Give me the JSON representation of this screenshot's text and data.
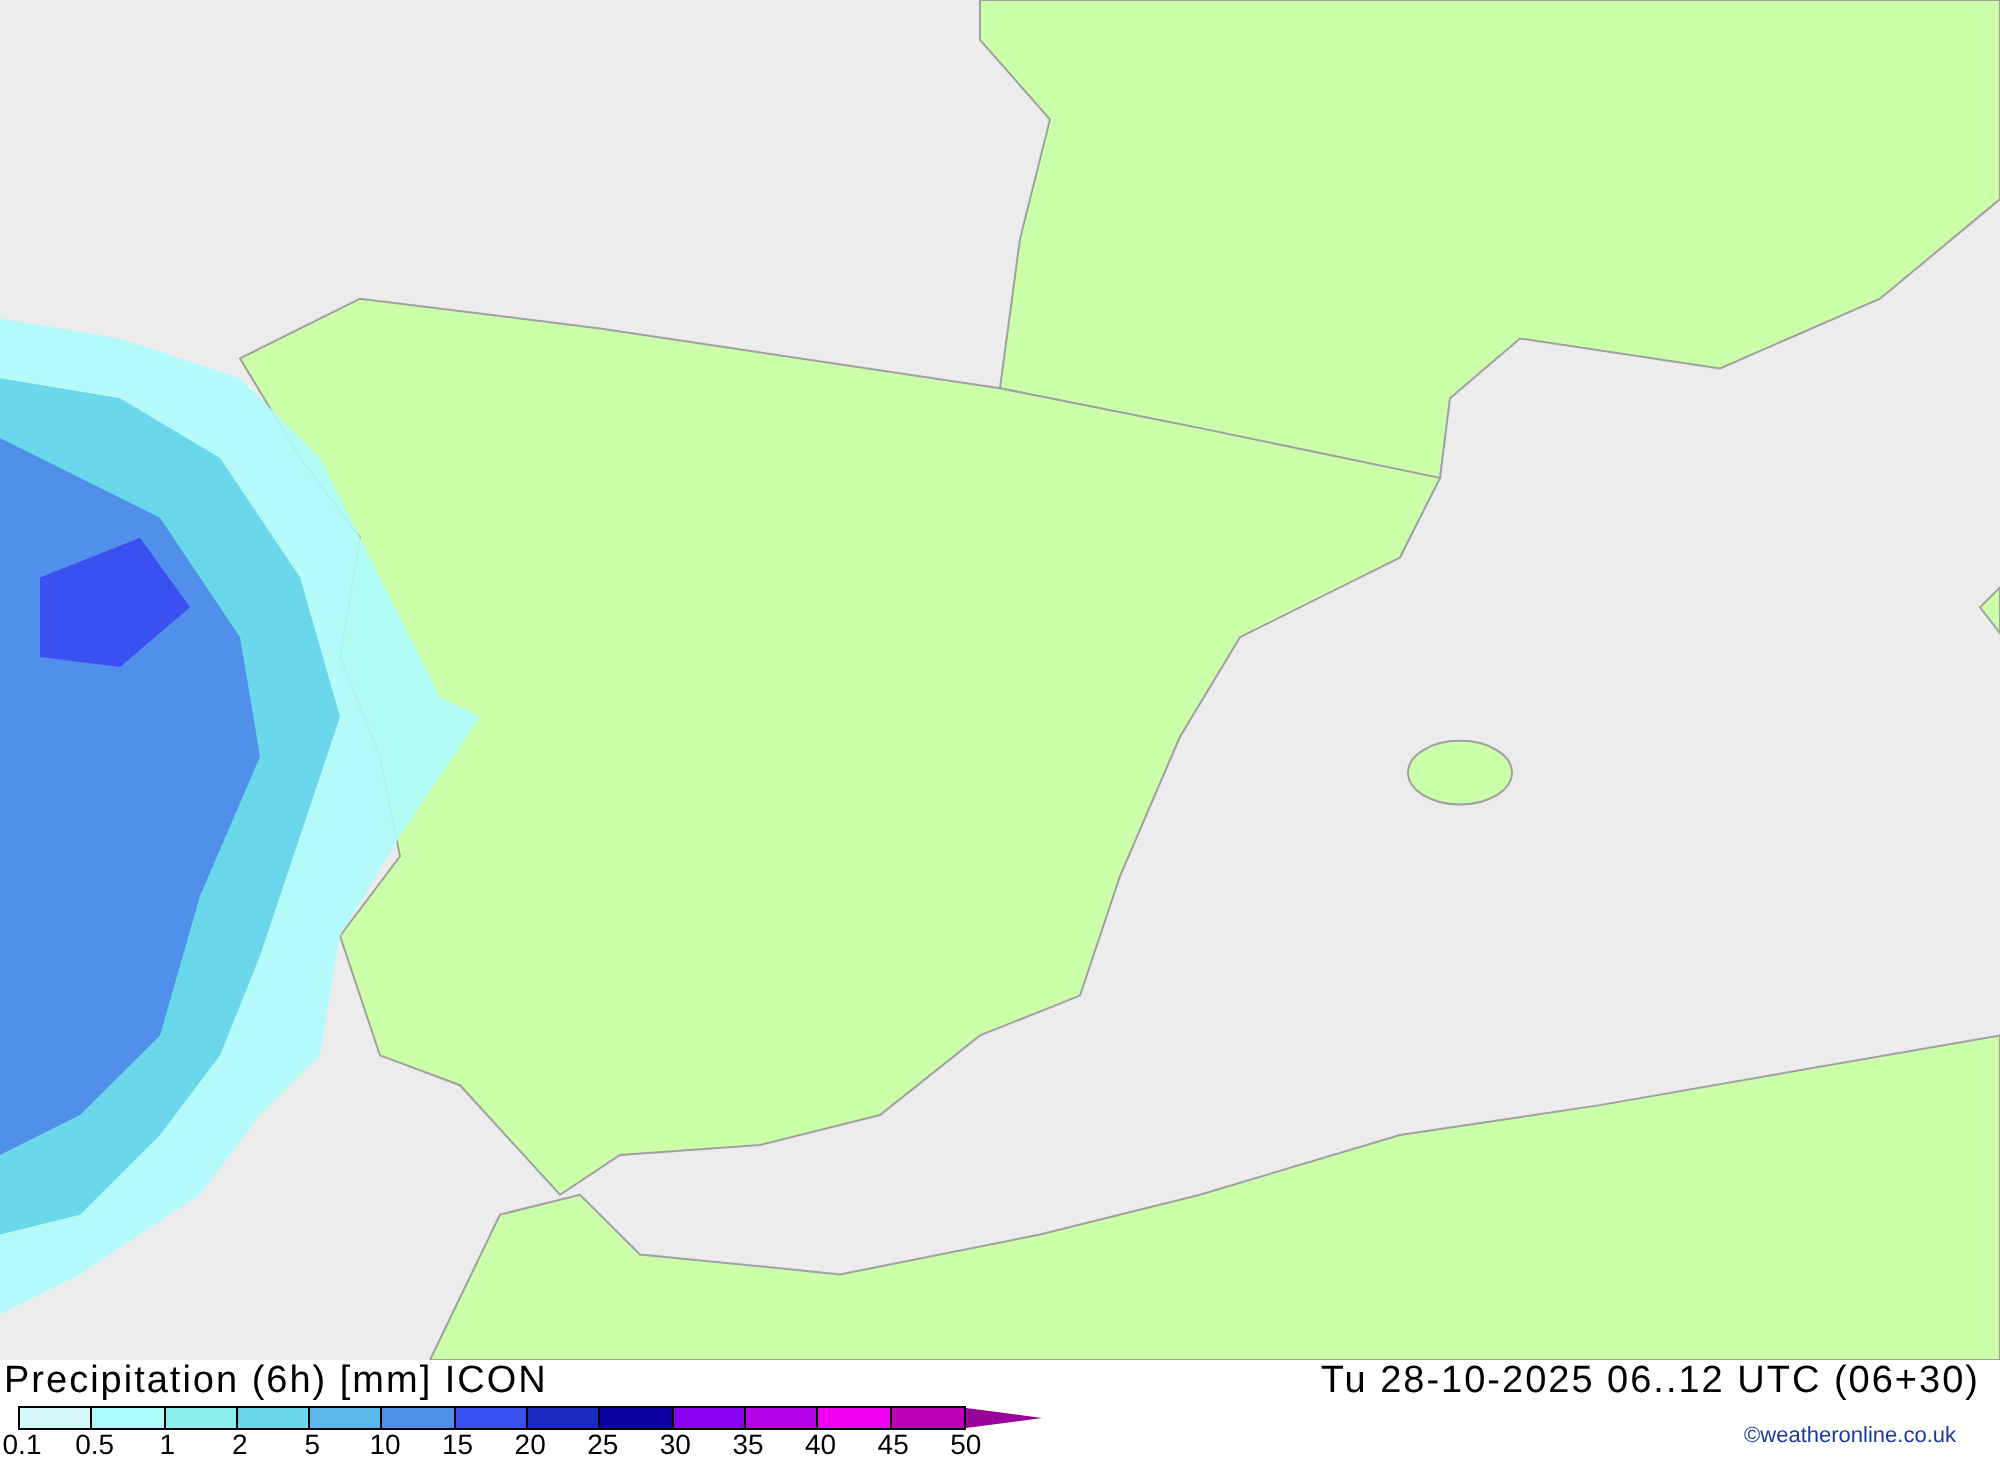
{
  "legend": {
    "title": "Precipitation (6h) [mm] ICON",
    "valid_time": "Tu 28-10-2025 06..12 UTC (06+30)",
    "segments": [
      {
        "color": "#d4f8f8"
      },
      {
        "color": "#aefcfc"
      },
      {
        "color": "#8ceeea"
      },
      {
        "color": "#6ad8ea"
      },
      {
        "color": "#5ab8ea"
      },
      {
        "color": "#5090ea"
      },
      {
        "color": "#3a50f0"
      },
      {
        "color": "#1a2ac0"
      },
      {
        "color": "#0a00a0"
      },
      {
        "color": "#8a00f0"
      },
      {
        "color": "#b400e8"
      },
      {
        "color": "#f000f0"
      },
      {
        "color": "#c000b8"
      }
    ],
    "ticks": [
      "0.1",
      "0.5",
      "1",
      "2",
      "5",
      "10",
      "15",
      "20",
      "25",
      "30",
      "35",
      "40",
      "45",
      "50"
    ],
    "credit": "©weatheronline.co.uk"
  }
}
